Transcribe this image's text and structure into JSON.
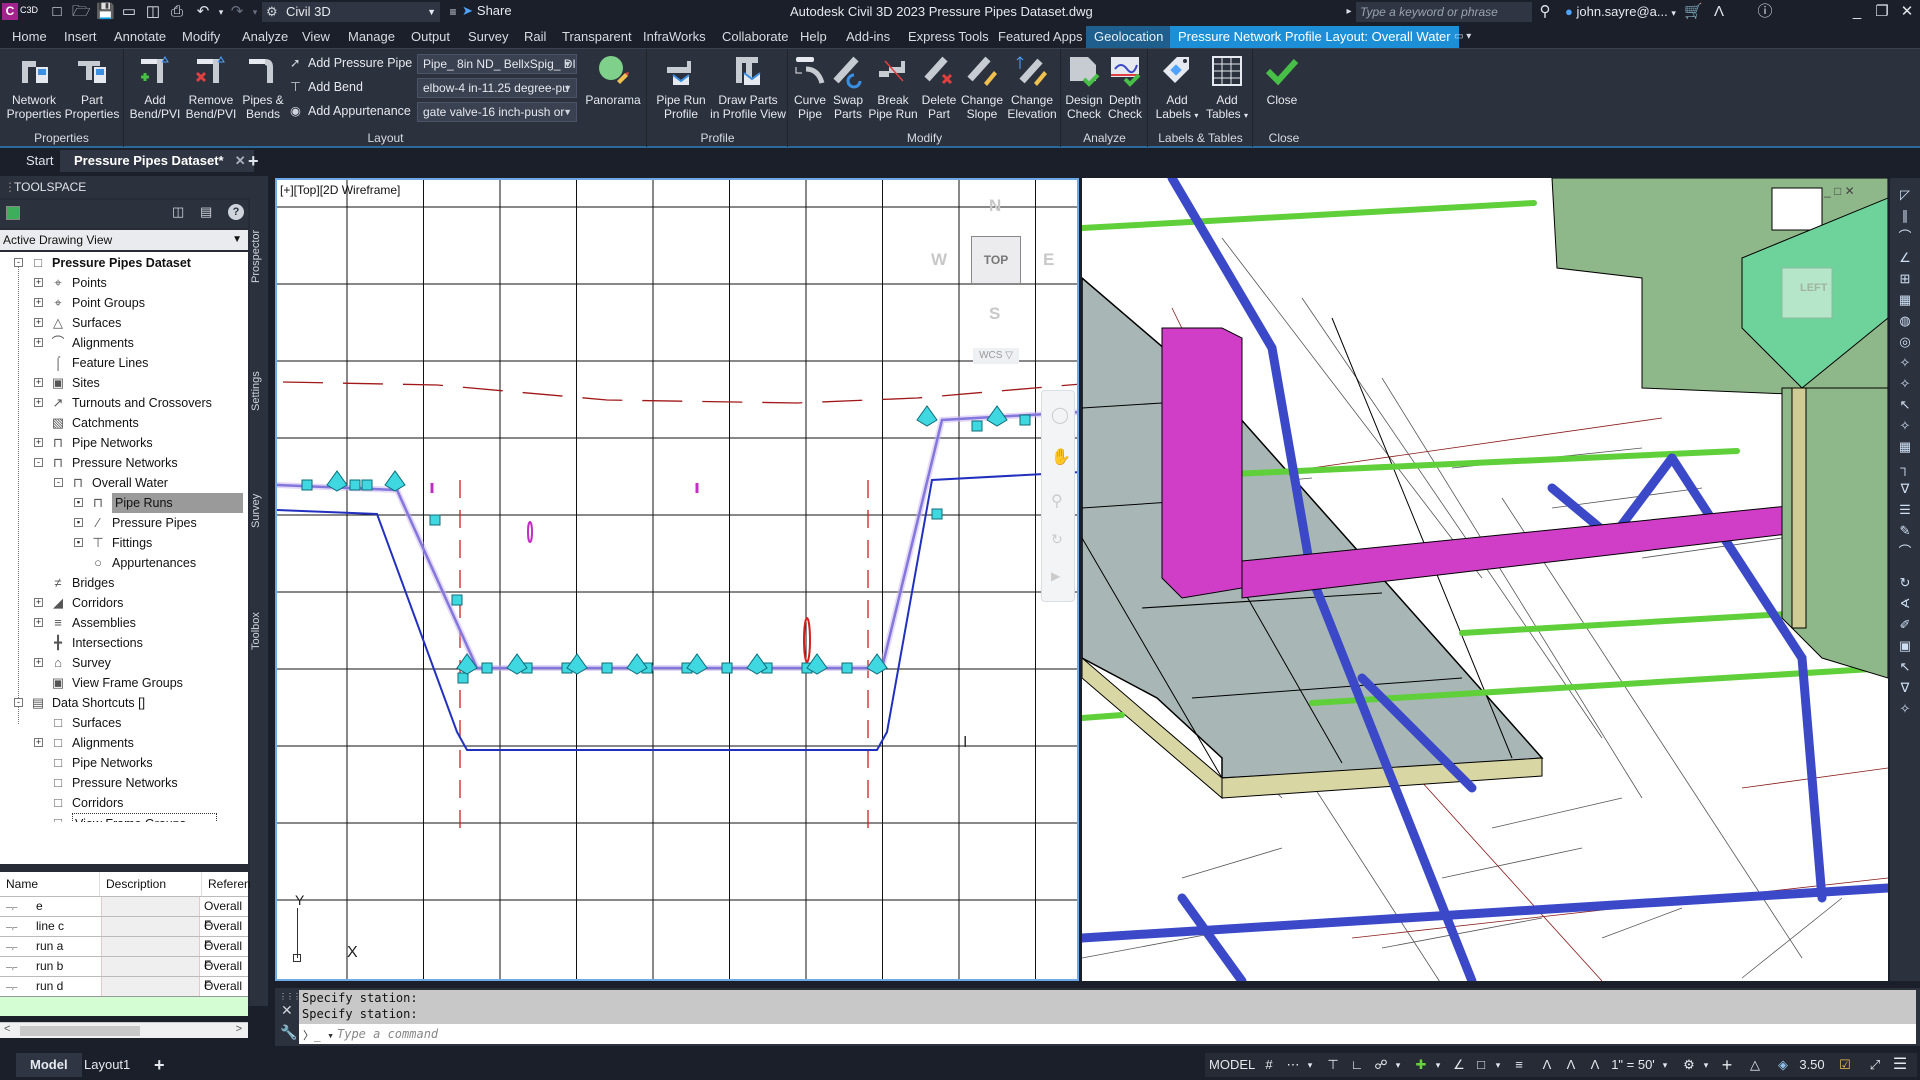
{
  "titlebar": {
    "app_badge": "C",
    "app_badge_sub": "C3D",
    "workspace": "Civil 3D",
    "share_label": "Share",
    "window_title": "Autodesk Civil 3D 2023   Pressure Pipes Dataset.dwg",
    "search_placeholder": "Type a keyword or phrase",
    "user": "john.sayre@a...",
    "minimize": "_",
    "restore": "❐",
    "close": "✕"
  },
  "menu_tabs": [
    "Home",
    "Insert",
    "Annotate",
    "Modify",
    "Analyze",
    "View",
    "Manage",
    "Output",
    "Survey",
    "Rail",
    "Transparent",
    "InfraWorks",
    "Collaborate",
    "Help",
    "Add-ins",
    "Express Tools",
    "Featured Apps",
    "Geolocation",
    "Pressure Network Profile Layout: Overall Water"
  ],
  "ribbon": {
    "panels": {
      "properties": "Properties",
      "layout": "Layout",
      "profile": "Profile",
      "modify": "Modify",
      "analyze": "Analyze",
      "labels_tables": "Labels & Tables",
      "close": "Close"
    },
    "buttons": {
      "network_properties": [
        "Network",
        "Properties"
      ],
      "part_properties": [
        "Part",
        "Properties"
      ],
      "add_bend": [
        "Add",
        "Bend/PVI"
      ],
      "remove_bend": [
        "Remove",
        "Bend/PVI"
      ],
      "pipes_bends": [
        "Pipes &",
        "Bends"
      ],
      "add_pressure_pipe": "Add Pressure Pipe",
      "add_bend_small": "Add Bend",
      "add_appurtenance": "Add Appurtenance",
      "panorama": "Panorama",
      "pipe_run_profile": [
        "Pipe Run",
        "Profile"
      ],
      "draw_parts": [
        "Draw Parts",
        "in Profile View"
      ],
      "curve_pipe": [
        "Curve",
        "Pipe"
      ],
      "swap_parts": [
        "Swap",
        "Parts"
      ],
      "break_pipe_run": [
        "Break",
        "Pipe Run"
      ],
      "delete_part": [
        "Delete",
        "Part"
      ],
      "change_slope": [
        "Change",
        "Slope"
      ],
      "change_elevation": [
        "Change",
        "Elevation"
      ],
      "design_check": [
        "Design",
        "Check"
      ],
      "depth_check": [
        "Depth",
        "Check"
      ],
      "add_labels": [
        "Add",
        "Labels"
      ],
      "add_tables": [
        "Add",
        "Tables"
      ],
      "close": "Close"
    },
    "combos": {
      "pipe": "Pipe_ 8in ND_ BellxSpig_ DI",
      "bend": "elbow-4 in-11.25 degree-pu",
      "appurtenance": "gate valve-16 inch-push or"
    }
  },
  "file_tabs": {
    "start": "Start",
    "active": "Pressure Pipes Dataset*",
    "add": "+"
  },
  "toolspace": {
    "title": "TOOLSPACE",
    "view_select": "Active Drawing View",
    "side_tabs": [
      "Prospector",
      "Settings",
      "Survey",
      "Toolbox"
    ],
    "tree": [
      {
        "label": "Pressure Pipes Dataset",
        "level": 0,
        "exp": "-",
        "icon": "drawing-icon",
        "bold": true
      },
      {
        "label": "Points",
        "level": 1,
        "exp": "+",
        "icon": "points-icon"
      },
      {
        "label": "Point Groups",
        "level": 1,
        "exp": "+",
        "icon": "point-groups-icon"
      },
      {
        "label": "Surfaces",
        "level": 1,
        "exp": "+",
        "icon": "surfaces-icon"
      },
      {
        "label": "Alignments",
        "level": 1,
        "exp": "+",
        "icon": "alignments-icon"
      },
      {
        "label": "Feature Lines",
        "level": 1,
        "exp": "",
        "icon": "feature-lines-icon"
      },
      {
        "label": "Sites",
        "level": 1,
        "exp": "+",
        "icon": "sites-icon"
      },
      {
        "label": "Turnouts and Crossovers",
        "level": 1,
        "exp": "+",
        "icon": "turnouts-icon"
      },
      {
        "label": "Catchments",
        "level": 1,
        "exp": "",
        "icon": "catchments-icon"
      },
      {
        "label": "Pipe Networks",
        "level": 1,
        "exp": "+",
        "icon": "pipe-networks-icon"
      },
      {
        "label": "Pressure Networks",
        "level": 1,
        "exp": "-",
        "icon": "pressure-networks-icon"
      },
      {
        "label": "Overall Water",
        "level": 2,
        "exp": "-",
        "icon": "pressure-network-icon"
      },
      {
        "label": "Pipe Runs",
        "level": 3,
        "exp": "▪",
        "icon": "pipe-runs-icon",
        "selected": true
      },
      {
        "label": "Pressure Pipes",
        "level": 3,
        "exp": "▪",
        "icon": "pressure-pipes-icon"
      },
      {
        "label": "Fittings",
        "level": 3,
        "exp": "▪",
        "icon": "fittings-icon"
      },
      {
        "label": "Appurtenances",
        "level": 3,
        "exp": "",
        "icon": "appurtenances-icon"
      },
      {
        "label": "Bridges",
        "level": 1,
        "exp": "",
        "icon": "bridges-icon"
      },
      {
        "label": "Corridors",
        "level": 1,
        "exp": "+",
        "icon": "corridors-icon"
      },
      {
        "label": "Assemblies",
        "level": 1,
        "exp": "+",
        "icon": "assemblies-icon"
      },
      {
        "label": "Intersections",
        "level": 1,
        "exp": "",
        "icon": "intersections-icon"
      },
      {
        "label": "Survey",
        "level": 1,
        "exp": "+",
        "icon": "survey-icon"
      },
      {
        "label": "View Frame Groups",
        "level": 1,
        "exp": "",
        "icon": "view-frame-groups-icon"
      },
      {
        "label": "Data Shortcuts []",
        "level": 0,
        "exp": "-",
        "icon": "data-shortcuts-icon"
      },
      {
        "label": "Surfaces",
        "level": 1,
        "exp": "",
        "icon": "surfaces-shortcut-icon"
      },
      {
        "label": "Alignments",
        "level": 1,
        "exp": "+",
        "icon": "alignments-shortcut-icon"
      },
      {
        "label": "Pipe Networks",
        "level": 1,
        "exp": "",
        "icon": "pipe-networks-shortcut-icon"
      },
      {
        "label": "Pressure Networks",
        "level": 1,
        "exp": "",
        "icon": "pressure-networks-shortcut-icon"
      },
      {
        "label": "Corridors",
        "level": 1,
        "exp": "",
        "icon": "corridors-shortcut-icon"
      },
      {
        "label": "View Frame Groups",
        "level": 1,
        "exp": "",
        "icon": "view-frame-groups-shortcut-icon",
        "focused": true
      }
    ],
    "grid": {
      "columns": [
        "Name",
        "Description",
        "Referen"
      ],
      "rows": [
        {
          "name": "e",
          "description": "",
          "reference": "Overall F"
        },
        {
          "name": "line c",
          "description": "",
          "reference": "Overall F"
        },
        {
          "name": "run a",
          "description": "",
          "reference": "Overall F"
        },
        {
          "name": "run b",
          "description": "",
          "reference": "Overall F"
        },
        {
          "name": "run d",
          "description": "",
          "reference": "Overall F"
        }
      ]
    }
  },
  "viewport_left": {
    "label": "[+][Top][2D Wireframe]",
    "viewcube": {
      "top": "TOP",
      "n": "N",
      "s": "S",
      "e": "E",
      "w": "W",
      "wcs": "WCS ▽"
    },
    "ucs": {
      "y": "Y",
      "x": "X"
    }
  },
  "viewport_right": {
    "viewcube_face": "LEFT"
  },
  "command_line": {
    "history": [
      "Specify station:",
      "Specify station:"
    ],
    "placeholder": "Type a command"
  },
  "status": {
    "layout_tabs": [
      "Model",
      "Layout1"
    ],
    "add_tab": "+",
    "model_label": "MODEL",
    "scale": "1\" = 50'",
    "lineweight": "3.50"
  },
  "colors": {
    "accent": "#1c8fd6",
    "geolocation_tab": "#1e5f8e",
    "pipe_cyan": "#3fd7e0",
    "pipe_blue": "#3b49c9",
    "green_pipe": "#6ad13f",
    "magenta_pipe": "#d43fcf"
  }
}
